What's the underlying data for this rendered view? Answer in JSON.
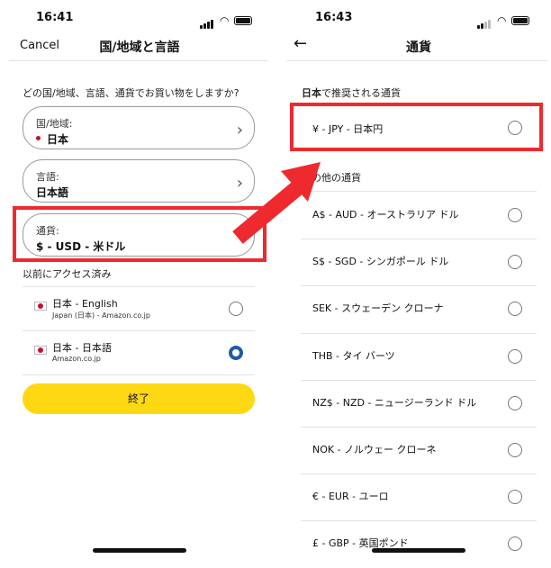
{
  "left": {
    "time": "16:41",
    "cancel": "Cancel",
    "title": "国/地域と言語",
    "question": "どの国/地域、言語、通貨でお買い物をしますか?",
    "region_label": "国/地域:",
    "region_value": "日本",
    "language_label": "言語:",
    "language_value": "日本語",
    "currency_label": "通貨:",
    "currency_value": "$ - USD - 米ドル",
    "recent_header": "以前にアクセス済み",
    "recent": [
      {
        "title": "日本 - English",
        "sub": "Japan (日本) - Amazon.co.jp",
        "selected": false
      },
      {
        "title": "日本 - 日本語",
        "sub": "Amazon.co.jp",
        "selected": true
      }
    ],
    "done": "終了"
  },
  "right": {
    "time": "16:43",
    "title": "通貨",
    "recommended_header_bold": "日本",
    "recommended_header_rest": "で推奨される通貨",
    "recommended": "¥ - JPY - 日本円",
    "others_header": "の他の通貨",
    "currencies": [
      "A$ - AUD - オーストラリア ドル",
      "S$ - SGD - シンガポール ドル",
      "SEK - スウェーデン クローナ",
      "THB - タイ バーツ",
      "NZ$ - NZD - ニュージーランド ドル",
      "NOK - ノルウェー クローネ",
      "€ - EUR - ユーロ",
      "£ - GBP - 英国ポンド"
    ]
  },
  "colors": {
    "accent_red": "#ee2a2f",
    "done_yellow": "#ffd814",
    "radio_blue": "#1f5aa8"
  }
}
